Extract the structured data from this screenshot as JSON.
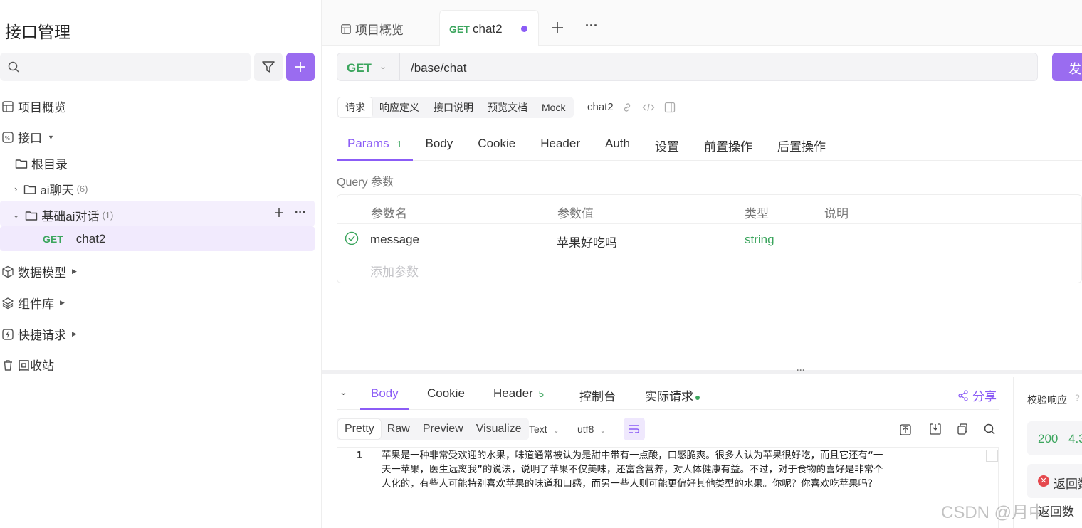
{
  "sidebar": {
    "title": "接口管理",
    "nav": {
      "overview": "项目概览",
      "api": "接口",
      "root": "根目录",
      "folder1": {
        "name": "ai聊天",
        "count": "(6)"
      },
      "folder2": {
        "name": "基础ai对话",
        "count": "(1)"
      },
      "endpoint": {
        "method": "GET",
        "name": "chat2"
      },
      "models": "数据模型",
      "components": "组件库",
      "quick": "快捷请求",
      "trash": "回收站"
    }
  },
  "tabs": {
    "overview": "项目概览",
    "active": {
      "method": "GET",
      "name": "chat2"
    }
  },
  "request": {
    "method": "GET",
    "url": "/base/chat",
    "send_label": "发",
    "subtabs": [
      "请求",
      "响应定义",
      "接口说明",
      "预览文档",
      "Mock"
    ],
    "name": "chat2",
    "param_tabs": {
      "params": "Params",
      "params_count": "1",
      "body": "Body",
      "cookie": "Cookie",
      "header": "Header",
      "auth": "Auth",
      "settings": "设置",
      "pre": "前置操作",
      "post": "后置操作"
    },
    "query_label": "Query 参数",
    "columns": {
      "name": "参数名",
      "value": "参数值",
      "type": "类型",
      "desc": "说明"
    },
    "param": {
      "name": "message",
      "value": "苹果好吃吗",
      "type": "string"
    },
    "add_placeholder": "添加参数"
  },
  "response": {
    "tabs": {
      "body": "Body",
      "cookie": "Cookie",
      "header": "Header",
      "header_count": "5",
      "console": "控制台",
      "actual": "实际请求"
    },
    "share": "分享",
    "formats": [
      "Pretty",
      "Raw",
      "Preview",
      "Visualize"
    ],
    "text_select": "Text",
    "encoding": "utf8",
    "line_no": "1",
    "lines": [
      "苹果是一种非常受欢迎的水果，味道通常被认为是甜中带有一点酸，口感脆爽。很多人认为苹果很好吃，而且它还有“一",
      "天一苹果，医生远离我”的说法，说明了苹果不仅美味，还富含营养，对人体健康有益。不过，对于食物的喜好是非常个",
      "人化的，有些人可能特别喜欢苹果的味道和口感，而另一些人则可能更偏好其他类型的水果。你呢？你喜欢吃苹果吗？"
    ]
  },
  "right_panel": {
    "title": "校验响应",
    "status": "200",
    "time": "4.3",
    "error": "返回数",
    "extra": "返回数"
  },
  "watermark": "CSDN @月中"
}
